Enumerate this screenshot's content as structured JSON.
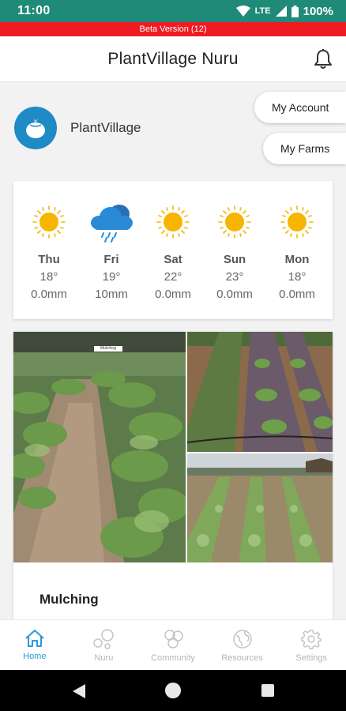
{
  "status_bar": {
    "time": "11:00",
    "network": "LTE",
    "battery": "100%"
  },
  "beta_banner": "Beta Version (12)",
  "header": {
    "title": "PlantVillage Nuru",
    "notification_icon": "bell-icon"
  },
  "profile": {
    "name": "PlantVillage",
    "avatar_icon": "tomato-icon"
  },
  "buttons": {
    "my_account": "My Account",
    "my_farms": "My Farms"
  },
  "weather": {
    "days": [
      {
        "day": "Thu",
        "temp": "18°",
        "rain": "0.0mm",
        "icon": "sun-icon"
      },
      {
        "day": "Fri",
        "temp": "19°",
        "rain": "10mm",
        "icon": "rain-cloud-icon"
      },
      {
        "day": "Sat",
        "temp": "22°",
        "rain": "0.0mm",
        "icon": "sun-icon"
      },
      {
        "day": "Sun",
        "temp": "23°",
        "rain": "0.0mm",
        "icon": "sun-icon"
      },
      {
        "day": "Mon",
        "temp": "18°",
        "rain": "0.0mm",
        "icon": "sun-icon"
      }
    ]
  },
  "article": {
    "title": "Mulching",
    "photo_label": "Mulching"
  },
  "bottom_nav": [
    {
      "label": "Home",
      "icon": "home-icon",
      "active": true
    },
    {
      "label": "Nuru",
      "icon": "nuru-icon",
      "active": false
    },
    {
      "label": "Community",
      "icon": "community-icon",
      "active": false
    },
    {
      "label": "Resources",
      "icon": "globe-icon",
      "active": false
    },
    {
      "label": "Settings",
      "icon": "gear-icon",
      "active": false
    }
  ],
  "colors": {
    "status_bar": "#1f8a78",
    "beta": "#ee1b23",
    "accent": "#2a9bd6",
    "sun": "#f7b500",
    "rain_cloud": "#2a8ad6"
  }
}
